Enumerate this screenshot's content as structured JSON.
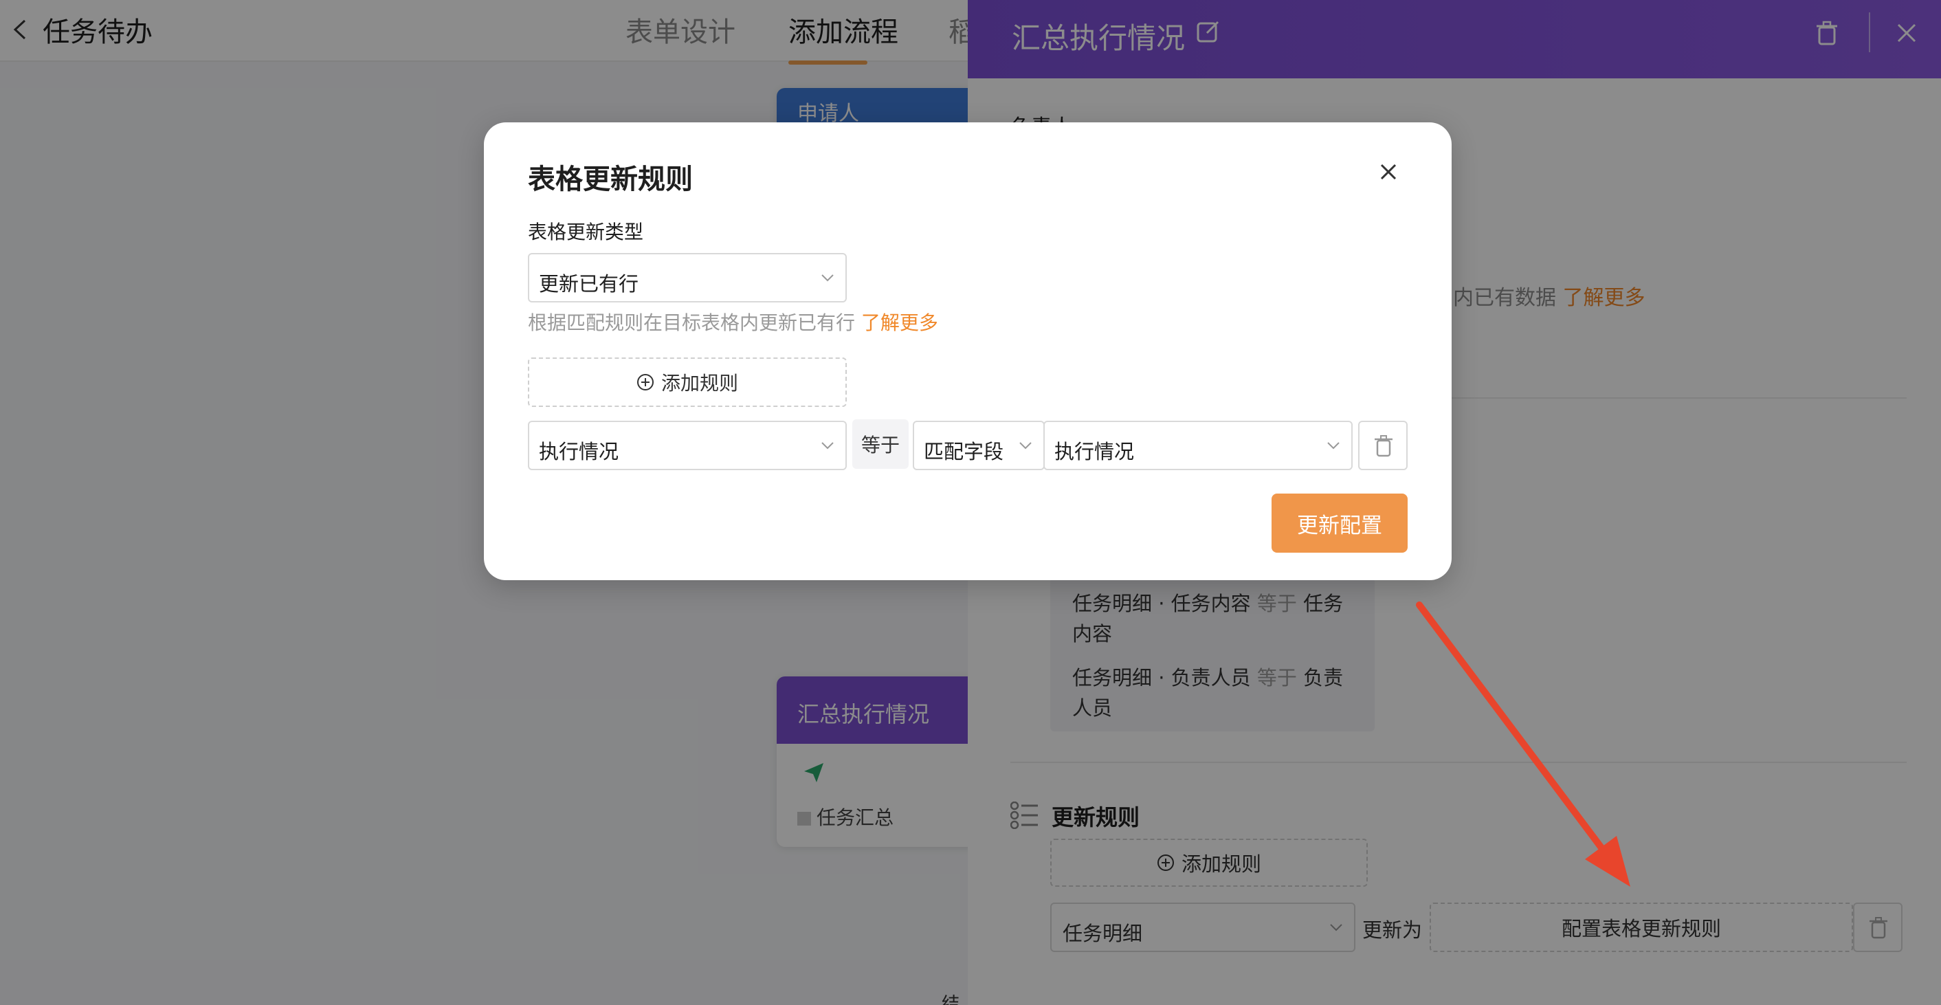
{
  "topbar": {
    "app_title": "任务待办",
    "tabs": [
      {
        "label": "表单设计"
      },
      {
        "label": "添加流程"
      },
      {
        "label": "稻"
      }
    ]
  },
  "canvas": {
    "node_summary_title": "汇总执行情况",
    "node_summary_item": "任务汇总",
    "node_top_title": "申请人",
    "bottom_text": "结"
  },
  "drawer": {
    "title": "汇总执行情况",
    "owner_label": "负责人",
    "help_text_tail": "内已有数据",
    "help_link": "了解更多",
    "conditions": [
      {
        "field": "任务明细 · 任务内容",
        "op": "等于",
        "value": "任务内容"
      },
      {
        "field": "任务明细 · 负责人员",
        "op": "等于",
        "value": "负责人员"
      }
    ],
    "rules_title": "更新规则",
    "add_rule_label": "添加规则",
    "rule_field": "任务明细",
    "update_to_label": "更新为",
    "config_rules_label": "配置表格更新规则"
  },
  "modal": {
    "title": "表格更新规则",
    "type_label": "表格更新类型",
    "type_value": "更新已有行",
    "help_text": "根据匹配规则在目标表格内更新已有行",
    "help_link": "了解更多",
    "add_rule_label": "添加规则",
    "rule": {
      "left_field": "执行情况",
      "operator": "等于",
      "match_type": "匹配字段",
      "right_field": "执行情况"
    },
    "update_button": "更新配置"
  },
  "colors": {
    "accent_orange": "#f0964a",
    "link_orange": "#f0882a",
    "drawer_header": "#7c4fd6",
    "annotation_arrow": "#e8452c"
  },
  "icons": [
    "back-icon",
    "edit-icon",
    "trash-icon",
    "close-icon",
    "plus-circle-icon",
    "chevron-down-icon",
    "list-icon",
    "send-icon",
    "arrow-annotation"
  ]
}
